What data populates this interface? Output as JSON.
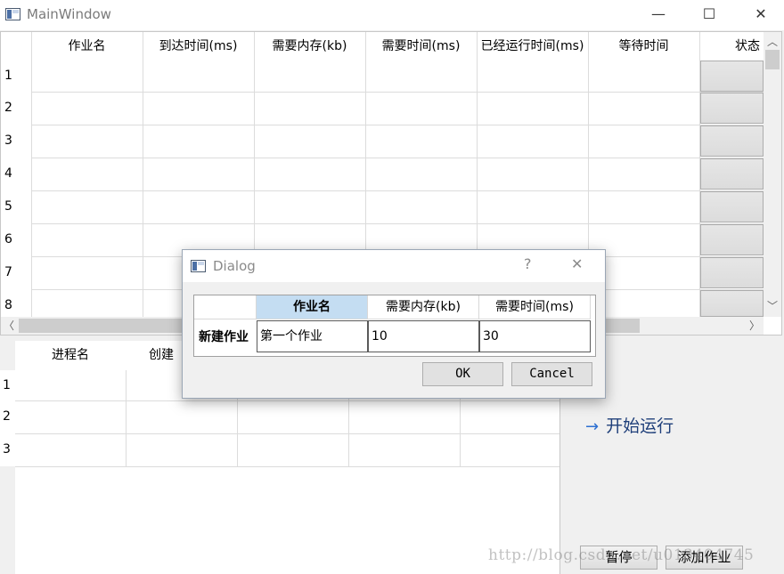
{
  "window": {
    "title": "MainWindow",
    "minimize": "—",
    "maximize": "☐",
    "close": "✕"
  },
  "job_table": {
    "columns": [
      "作业名",
      "到达时间(ms)",
      "需要内存(kb)",
      "需要时间(ms)",
      "已经运行时间(ms)",
      "等待时间",
      "状态"
    ],
    "row_numbers": [
      "1",
      "2",
      "3",
      "4",
      "5",
      "6",
      "7",
      "8"
    ]
  },
  "proc_table": {
    "columns": [
      "进程名",
      "创建"
    ],
    "row_numbers": [
      "1",
      "2",
      "3"
    ]
  },
  "right_panel": {
    "start_label": "开始运行",
    "pause_label": "暂停",
    "add_job_label": "添加作业"
  },
  "watermark": "http://blog.csdn.net/u013404745",
  "dialog": {
    "title": "Dialog",
    "help": "?",
    "close": "✕",
    "row_header": "新建作业",
    "columns": [
      "作业名",
      "需要内存(kb)",
      "需要时间(ms)"
    ],
    "values": {
      "name": "第一个作业",
      "memory": "10",
      "time": "30"
    },
    "ok_label": "OK",
    "cancel_label": "Cancel"
  }
}
